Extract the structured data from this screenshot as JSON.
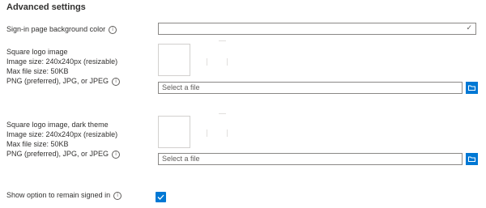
{
  "section": {
    "title": "Advanced settings"
  },
  "background_color": {
    "label": "Sign-in page background color",
    "value": ""
  },
  "logo": {
    "line1": "Square logo image",
    "line2": "Image size: 240x240px (resizable)",
    "line3": "Max file size: 50KB",
    "line4": "PNG (preferred), JPG, or JPEG",
    "file_placeholder": "Select a file"
  },
  "logo_dark": {
    "line1": "Square logo image, dark theme",
    "line2": "Image size: 240x240px (resizable)",
    "line3": "Max file size: 50KB",
    "line4": "PNG (preferred), JPG, or JPEG",
    "file_placeholder": "Select a file"
  },
  "remain_signed_in": {
    "label": "Show option to remain signed in",
    "checked": true
  },
  "icons": {
    "info": "info-icon",
    "chevron": "chevron-down-icon",
    "folder": "folder-icon",
    "check": "checkmark-icon"
  },
  "colors": {
    "accent": "#0078d4",
    "border": "#8a8886",
    "text": "#323130"
  }
}
